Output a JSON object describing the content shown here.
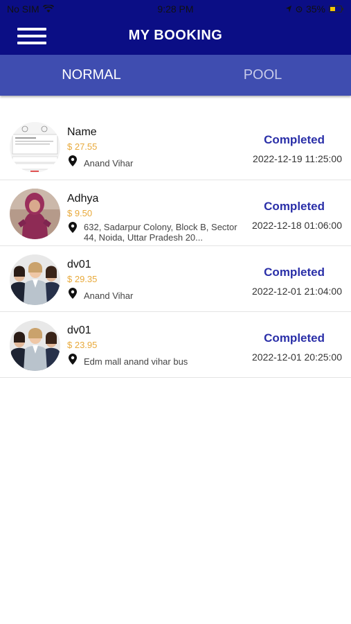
{
  "status_bar": {
    "carrier": "No SIM",
    "time": "9:28 PM",
    "battery": "35%"
  },
  "header": {
    "title": "MY BOOKING",
    "menu_icon": "hamburger-icon"
  },
  "tabs": [
    {
      "label": "NORMAL",
      "active": true
    },
    {
      "label": "POOL",
      "active": false
    }
  ],
  "colors": {
    "header_bg": "#0b0e85",
    "tab_bg": "#3f4db0",
    "price": "#e8a93a",
    "status": "#2a2fa8"
  },
  "bookings": [
    {
      "name": "Name",
      "price": "$ 27.55",
      "address": "Anand Vihar",
      "status": "Completed",
      "datetime": "2022-12-19 11:25:00",
      "avatar": "document-screenshot"
    },
    {
      "name": "Adhya",
      "price": "$ 9.50",
      "address": "632, Sadarpur Colony, Block B, Sector 44, Noida, Uttar Pradesh 20...",
      "status": "Completed",
      "datetime": "2022-12-18 01:06:00",
      "avatar": "child-photo"
    },
    {
      "name": "dv01",
      "price": "$ 29.35",
      "address": "Anand Vihar",
      "status": "Completed",
      "datetime": "2022-12-01 21:04:00",
      "avatar": "group-photo"
    },
    {
      "name": "dv01",
      "price": "$ 23.95",
      "address": "Edm mall anand vihar bus",
      "status": "Completed",
      "datetime": "2022-12-01 20:25:00",
      "avatar": "group-photo"
    }
  ]
}
